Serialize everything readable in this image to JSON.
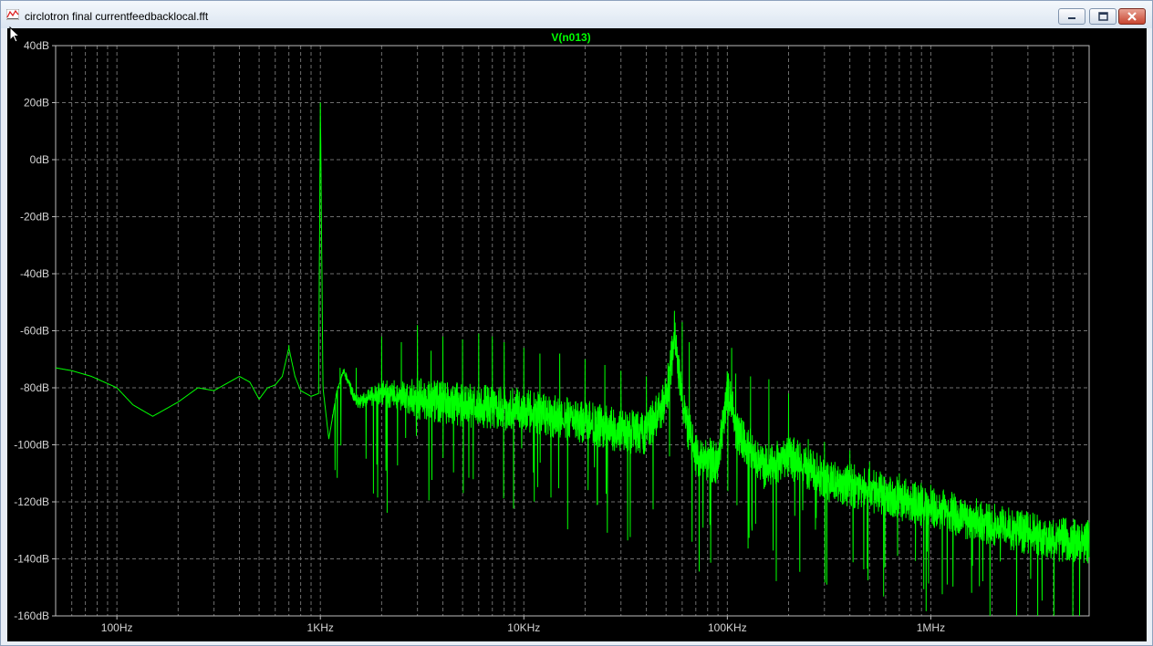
{
  "window": {
    "title": "circlotron final currentfeedbacklocal.fft"
  },
  "colors": {
    "background": "#000000",
    "trace": "#00ff00",
    "axis_text": "#d4d4d4",
    "grid": "#6e6e6e"
  },
  "icons": [
    "waveform-app-icon",
    "minimize-icon",
    "maximize-icon",
    "close-icon",
    "mouse-pointer-icon"
  ],
  "chart_data": {
    "type": "line",
    "title": "V(n013)",
    "xscale": "log",
    "xlim": [
      50,
      6000000
    ],
    "ylim": [
      -160,
      40
    ],
    "grid": true,
    "x_ticks": [
      {
        "value": 100,
        "label": "100Hz"
      },
      {
        "value": 1000,
        "label": "1KHz"
      },
      {
        "value": 10000,
        "label": "10KHz"
      },
      {
        "value": 100000,
        "label": "100KHz"
      },
      {
        "value": 1000000,
        "label": "1MHz"
      }
    ],
    "y_ticks": [
      {
        "value": 40,
        "label": "40dB"
      },
      {
        "value": 20,
        "label": "20dB"
      },
      {
        "value": 0,
        "label": "0dB"
      },
      {
        "value": -20,
        "label": "-20dB"
      },
      {
        "value": -40,
        "label": "-40dB"
      },
      {
        "value": -60,
        "label": "-60dB"
      },
      {
        "value": -80,
        "label": "-80dB"
      },
      {
        "value": -100,
        "label": "-100dB"
      },
      {
        "value": -120,
        "label": "-120dB"
      },
      {
        "value": -140,
        "label": "-140dB"
      },
      {
        "value": -160,
        "label": "-160dB"
      }
    ],
    "series": [
      {
        "name": "V(n013)",
        "color": "#00ff00",
        "envelope": [
          [
            50,
            -73
          ],
          [
            60,
            -74
          ],
          [
            75,
            -76
          ],
          [
            100,
            -80
          ],
          [
            120,
            -86
          ],
          [
            150,
            -90
          ],
          [
            200,
            -85
          ],
          [
            250,
            -80
          ],
          [
            300,
            -81
          ],
          [
            400,
            -76
          ],
          [
            450,
            -78
          ],
          [
            500,
            -84
          ],
          [
            550,
            -80
          ],
          [
            600,
            -79
          ],
          [
            650,
            -76
          ],
          [
            700,
            -66
          ],
          [
            750,
            -76
          ],
          [
            800,
            -81
          ],
          [
            900,
            -83
          ],
          [
            980,
            -82
          ],
          [
            1000,
            20
          ],
          [
            1030,
            -80
          ],
          [
            1100,
            -98
          ],
          [
            1200,
            -82
          ],
          [
            1300,
            -74
          ],
          [
            1500,
            -85
          ],
          [
            2000,
            -82
          ],
          [
            5000,
            -86
          ],
          [
            10000,
            -88
          ],
          [
            20000,
            -92
          ],
          [
            30000,
            -95
          ],
          [
            40000,
            -96
          ],
          [
            50000,
            -84
          ],
          [
            55000,
            -62
          ],
          [
            60000,
            -86
          ],
          [
            70000,
            -104
          ],
          [
            90000,
            -106
          ],
          [
            100000,
            -80
          ],
          [
            110000,
            -94
          ],
          [
            150000,
            -108
          ],
          [
            200000,
            -104
          ],
          [
            300000,
            -112
          ],
          [
            500000,
            -116
          ],
          [
            1000000,
            -122
          ],
          [
            2000000,
            -128
          ],
          [
            4000000,
            -133
          ],
          [
            6000000,
            -134
          ]
        ],
        "peaks": [
          [
            700,
            -65
          ],
          [
            1000,
            20
          ],
          [
            1250,
            -73
          ],
          [
            1500,
            -73
          ],
          [
            2000,
            -62
          ],
          [
            2500,
            -64
          ],
          [
            3000,
            -58
          ],
          [
            3500,
            -67
          ],
          [
            4000,
            -62
          ],
          [
            5000,
            -63
          ],
          [
            6000,
            -61
          ],
          [
            7000,
            -62
          ],
          [
            8000,
            -64
          ],
          [
            10000,
            -66
          ],
          [
            12000,
            -68
          ],
          [
            15000,
            -68
          ],
          [
            20000,
            -70
          ],
          [
            25000,
            -72
          ],
          [
            30000,
            -74
          ],
          [
            40000,
            -76
          ],
          [
            55000,
            -53
          ],
          [
            60000,
            -57
          ],
          [
            65000,
            -64
          ],
          [
            105000,
            -66
          ],
          [
            110000,
            -75
          ],
          [
            130000,
            -76
          ],
          [
            160000,
            -77
          ],
          [
            200000,
            -82
          ],
          [
            250000,
            -98
          ],
          [
            300000,
            -99
          ],
          [
            400000,
            -102
          ],
          [
            500000,
            -106
          ],
          [
            700000,
            -110
          ],
          [
            1000000,
            -114
          ],
          [
            2000000,
            -123
          ]
        ],
        "noise_band_db": 12
      }
    ]
  }
}
